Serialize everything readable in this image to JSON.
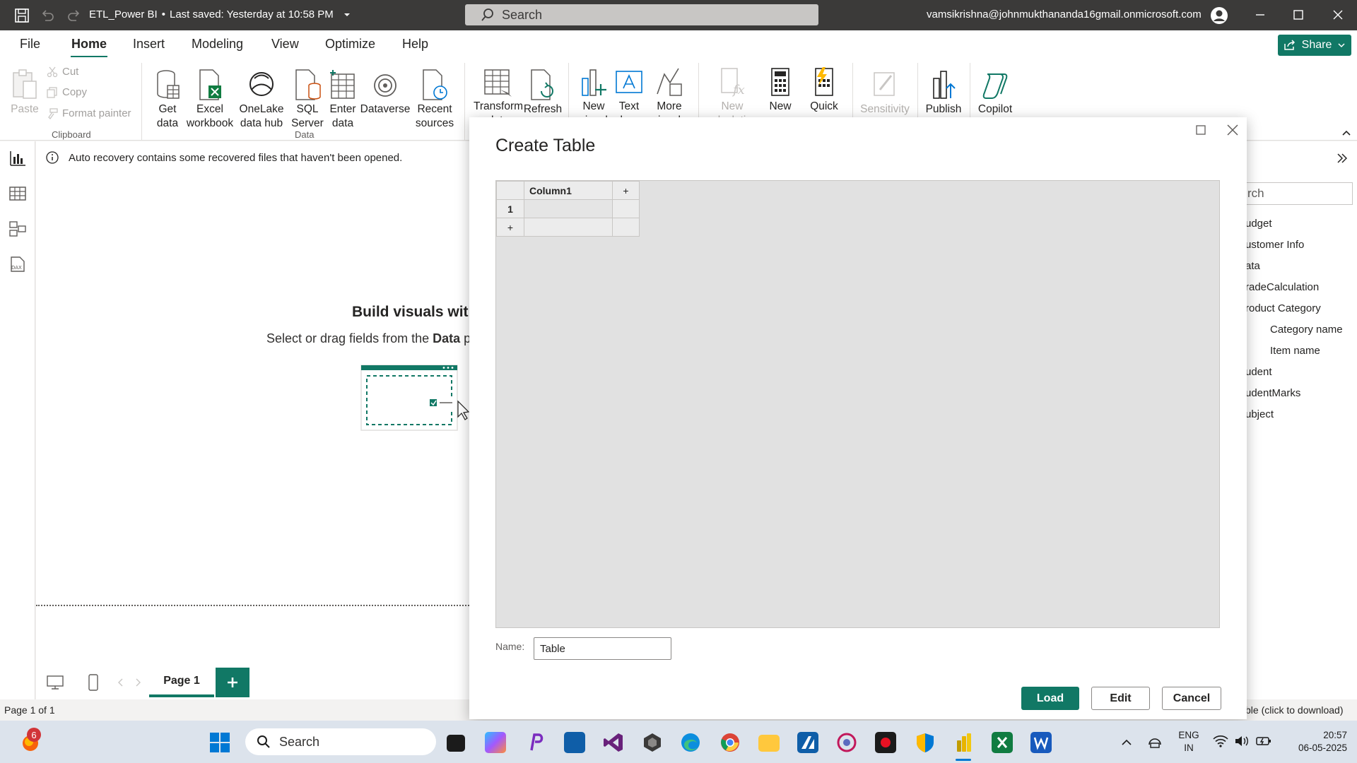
{
  "titlebar": {
    "doc_title": "ETL_Power BI",
    "saved_status": "Last saved: Yesterday at 10:58 PM",
    "search_placeholder": "Search",
    "account": "vamsikrishna@johnmukthananda16gmail.onmicrosoft.com"
  },
  "menu": {
    "items": [
      "File",
      "Home",
      "Insert",
      "Modeling",
      "View",
      "Optimize",
      "Help"
    ],
    "active": "Home",
    "share_label": "Share"
  },
  "ribbon": {
    "clipboard": {
      "paste": "Paste",
      "cut": "Cut",
      "copy": "Copy",
      "format_painter": "Format painter",
      "group": "Clipboard"
    },
    "data": {
      "get_data": "Get data",
      "excel": "Excel workbook",
      "onelake": "OneLake data hub",
      "sql": "SQL Server",
      "enter_data": "Enter data",
      "dataverse": "Dataverse",
      "recent": "Recent sources",
      "group": "Data"
    },
    "queries": {
      "transform": "Transform data",
      "refresh": "Refresh"
    },
    "insert": {
      "new_visual": "New visual",
      "text_box": "Text box",
      "more_visuals": "More visuals"
    },
    "calculations": {
      "new_calc": "New calculation",
      "new_measure": "New measure",
      "quick_measure": "Quick measure"
    },
    "sensitivity": "Sensitivity",
    "publish": "Publish",
    "copilot": "Copilot"
  },
  "canvas": {
    "recovery_msg": "Auto recovery contains some recovered files that haven't been opened.",
    "build_title": "Build visuals with",
    "build_sub_pre": "Select or drag fields from the ",
    "build_sub_bold": "Data",
    "build_sub_post": " p"
  },
  "pages": {
    "tab": "Page 1",
    "status": "Page 1 of 1"
  },
  "right_pane": {
    "search": "rch",
    "items": [
      "udget",
      "ustomer Info",
      "ata",
      "radeCalculation",
      "roduct Category",
      "Category name",
      "Item name",
      "udent",
      "udentMarks",
      "ubject"
    ],
    "status": "ble (click to download)"
  },
  "dialog": {
    "title": "Create Table",
    "column_header": "Column1",
    "add_col": "+",
    "row_number": "1",
    "add_row": "+",
    "name_label": "Name:",
    "name_value": "Table",
    "load": "Load",
    "edit": "Edit",
    "cancel": "Cancel"
  },
  "taskbar": {
    "search": "Search",
    "badge": "6",
    "lang_top": "ENG",
    "lang_bottom": "IN",
    "time": "20:57",
    "date": "06-05-2025"
  },
  "colors": {
    "accent": "#117865",
    "titlebar": "#3b3a39",
    "taskbar": "#dce3ec"
  }
}
